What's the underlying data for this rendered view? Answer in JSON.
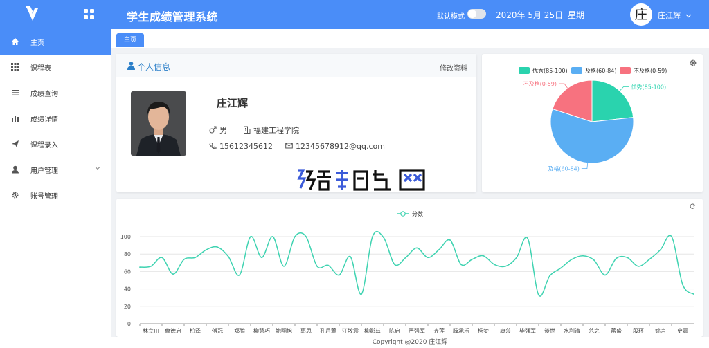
{
  "header": {
    "app_title": "学生成绩管理系统",
    "dark_mode_label": "默认模式",
    "date": "2020年 5月 25日",
    "weekday": "星期一",
    "avatar_char": "庄",
    "user_name": "庄江辉"
  },
  "sidebar": {
    "items": [
      {
        "label": "主页",
        "icon": "home-icon"
      },
      {
        "label": "课程表",
        "icon": "grid-icon"
      },
      {
        "label": "成绩查询",
        "icon": "list-icon"
      },
      {
        "label": "成绩详情",
        "icon": "bar-chart-icon"
      },
      {
        "label": "课程录入",
        "icon": "send-icon"
      },
      {
        "label": "用户管理",
        "icon": "user-icon"
      },
      {
        "label": "账号管理",
        "icon": "gear-icon"
      }
    ]
  },
  "tabs": {
    "home": "主页"
  },
  "profile": {
    "title": "个人信息",
    "edit_label": "修改资料",
    "name": "庄江辉",
    "gender": "男",
    "school": "福建工程学院",
    "phone": "15612345612",
    "email": "12345678912@qq.com"
  },
  "colors": {
    "primary": "#4a8df8",
    "excellent": "#2ad3ae",
    "pass": "#5aaef3",
    "fail": "#f7727f",
    "line": "#3fd3b1"
  },
  "chart_data": [
    {
      "type": "pie",
      "legend": [
        "优秀(85-100)",
        "及格(60-84)",
        "不及格(0-59)"
      ],
      "legend_placement": "top",
      "slices": [
        {
          "name": "优秀(85-100)",
          "value": 7
        },
        {
          "name": "及格(60-84)",
          "value": 17
        },
        {
          "name": "不及格(0-59)",
          "value": 6
        }
      ]
    },
    {
      "type": "line",
      "legend": [
        "分数"
      ],
      "legend_placement": "top",
      "ylim": [
        0,
        100
      ],
      "yticks": [
        0,
        20,
        40,
        60,
        80,
        100
      ],
      "grid": true,
      "x_tick_labels": [
        "林立川",
        "曹德启",
        "柏泽",
        "傅冠",
        "郑腾",
        "柳慧巧",
        "鲍翔旭",
        "惠思",
        "孔月莺",
        "汪敬震",
        "柳影兹",
        "陈启",
        "严强军",
        "齐莲",
        "滕承乐",
        "杨梦",
        "康莎",
        "毕强军",
        "谈世",
        "水利清",
        "范之",
        "蓝盛",
        "殷环",
        "姚言",
        "史震"
      ],
      "series": [
        {
          "name": "分数",
          "values": [
            65,
            66,
            76,
            57,
            74,
            76,
            85,
            88,
            77,
            56,
            100,
            76,
            100,
            66,
            100,
            100,
            66,
            67,
            56,
            77,
            34,
            100,
            99,
            68,
            76,
            87,
            76,
            85,
            96,
            68,
            74,
            78,
            68,
            66,
            76,
            98,
            33,
            55,
            64,
            74,
            78,
            73,
            56,
            75,
            76,
            66,
            74,
            85,
            100,
            45,
            34
          ]
        }
      ]
    }
  ],
  "footer": {
    "copyright": "Copyright @2020 庄江辉"
  }
}
